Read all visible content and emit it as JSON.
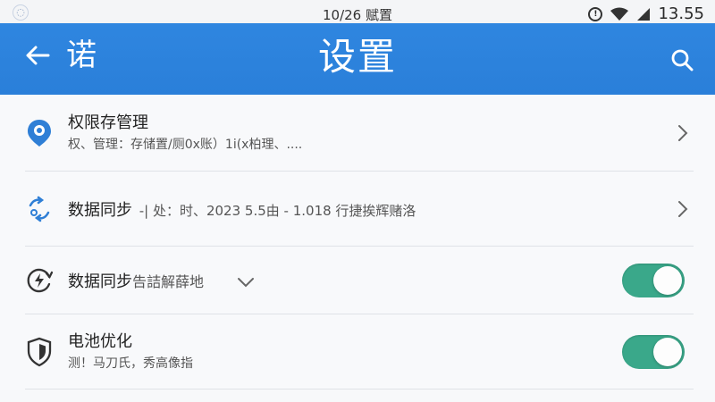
{
  "status_bar": {
    "center_text": "10/26 赋置",
    "time": "13.55",
    "left_icon": "app-logo-icon",
    "icons": [
      "vibrate-icon",
      "wifi-icon",
      "signal-icon"
    ]
  },
  "app_bar": {
    "back_icon": "arrow-left-icon",
    "subtitle": "诺",
    "title": "设置",
    "search_icon": "search-icon",
    "color": "#2f86e0"
  },
  "settings": [
    {
      "icon": "location-pin-icon",
      "title": "权限存管理",
      "subtitle": "权、管理：存储置/厕0x账）1i(x柏理、...."
    },
    {
      "icon": "sync-arrows-icon",
      "title": "数据同步",
      "meta": "-| 处：时、2023 5.5由 - 1.018 行捷挨辉赌洛"
    },
    {
      "icon": "sync-lightning-icon",
      "title": "数据同步",
      "meta": "告詰解薛地",
      "toggle_on": true
    },
    {
      "icon": "shield-icon",
      "title": "电池优化",
      "subtitle": "测！马刀氏，秀高像指",
      "toggle_on": true
    }
  ],
  "colors": {
    "accent": "#2f86e0",
    "toggle_on": "#3aa88a",
    "icon_blue": "#2f7fd6"
  }
}
